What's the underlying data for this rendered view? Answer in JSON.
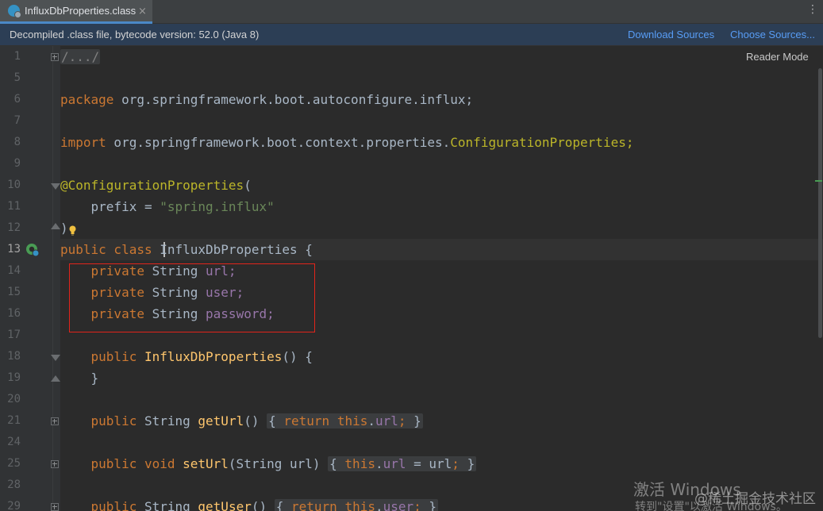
{
  "tab": {
    "title": "InfluxDbProperties.class",
    "close_glyph": "×",
    "icon": "java-class-icon"
  },
  "tabbar_menu": "⋮",
  "banner": {
    "text": "Decompiled .class file, bytecode version: 52.0 (Java 8)",
    "download_sources": "Download Sources",
    "choose_sources": "Choose Sources..."
  },
  "reader_mode": "Reader Mode",
  "line_numbers": [
    "1",
    "5",
    "6",
    "7",
    "8",
    "9",
    "10",
    "11",
    "12",
    "13",
    "14",
    "15",
    "16",
    "17",
    "18",
    "19",
    "20",
    "21",
    "24",
    "25",
    "28",
    "29"
  ],
  "current_line": "13",
  "code": {
    "l1": "/.../",
    "l6_kw": "package",
    "l6_rest": " org.springframework.boot.autoconfigure.influx;",
    "l8_kw": "import",
    "l8_pkg": " org.springframework.boot.context.properties.",
    "l8_cls": "ConfigurationProperties;",
    "l10_ann": "@ConfigurationProperties",
    "l10_paren": "(",
    "l11_key": "    prefix = ",
    "l11_str": "\"spring.influx\"",
    "l12": ")",
    "l13_kw": "public class ",
    "l13_name": "InfluxDbProperties",
    "l13_rest": " {",
    "l14_kw": "    private ",
    "l14_type": "String ",
    "l14_fld": "url;",
    "l15_kw": "    private ",
    "l15_type": "String ",
    "l15_fld": "user;",
    "l16_kw": "    private ",
    "l16_type": "String ",
    "l16_fld": "password;",
    "l18_kw": "    public ",
    "l18_mth": "InfluxDbProperties",
    "l18_rest": "() {",
    "l19": "    }",
    "l21_kw": "    public ",
    "l21_type": "String ",
    "l21_mth": "getUrl",
    "l21_paren": "() ",
    "l21_open": "{ ",
    "l21_ret": "return ",
    "l21_this": "this",
    "l21_dot": ".",
    "l21_fld": "url",
    "l21_semi": "; ",
    "l21_close": "}",
    "l25_kw": "    public void ",
    "l25_mth": "setUrl",
    "l25_args": "(String url) ",
    "l25_open": "{ ",
    "l25_this": "this",
    "l25_dot": ".",
    "l25_fld": "url",
    "l25_assign": " = url",
    "l25_semi": "; ",
    "l25_close": "}",
    "l29_kw": "    public ",
    "l29_type": "String ",
    "l29_mth": "getUser",
    "l29_paren": "() ",
    "l29_open": "{ ",
    "l29_ret": "return ",
    "l29_this": "this",
    "l29_dot": ".",
    "l29_fld": "user",
    "l29_semi": "; ",
    "l29_close": "}"
  },
  "watermark": {
    "activate": "激活 Windows",
    "goto": "转到\"设置\"以激活 Windows。",
    "credit": "@稀土掘金技术社区"
  },
  "colors": {
    "keyword": "#cc7832",
    "annotation": "#bbb529",
    "string": "#6a8759",
    "field": "#9876aa",
    "method": "#ffc66d",
    "text": "#a9b7c6",
    "highlight_box": "#e2241a"
  }
}
